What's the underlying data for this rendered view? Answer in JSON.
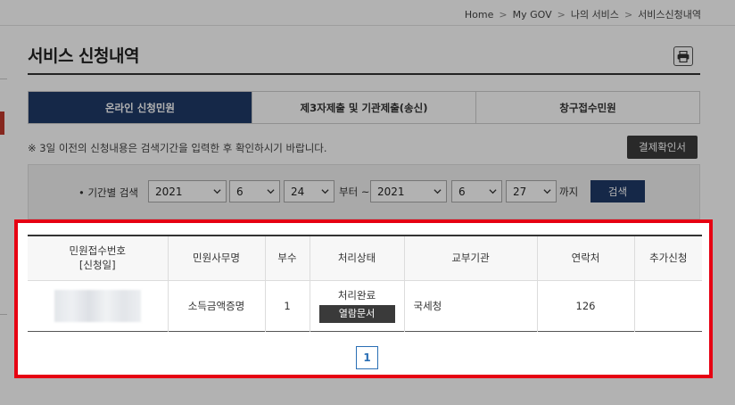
{
  "breadcrumb": [
    "Home",
    "My GOV",
    "나의 서비스",
    "서비스신청내역"
  ],
  "page": {
    "title": "서비스 신청내역"
  },
  "icons": {
    "print": "printer-icon",
    "caret": "chevron-down-icon"
  },
  "tabs": [
    {
      "label": "온라인 신청민원",
      "active": true
    },
    {
      "label": "제3자제출 및 기관제출(송신)",
      "active": false
    },
    {
      "label": "창구접수민원",
      "active": false
    }
  ],
  "notice": "※ 3일 이전의 신청내용은 검색기간을 입력한 후 확인하시기 바랍니다.",
  "receipt_button": "결제확인서",
  "search": {
    "label": "• 기간별 검색",
    "from": {
      "year": "2021",
      "month": "6",
      "day": "24"
    },
    "between": "부터 ~",
    "to": {
      "year": "2021",
      "month": "6",
      "day": "27"
    },
    "suffix": "까지",
    "button": "검색"
  },
  "table": {
    "headers": {
      "receipt_no": "민원접수번호",
      "receipt_date": "[신청일]",
      "service_name": "민원사무명",
      "copies": "부수",
      "status": "처리상태",
      "agency": "교부기관",
      "contact": "연락처",
      "extra": "추가신청"
    },
    "rows": [
      {
        "service_name": "소득금액증명",
        "copies": "1",
        "status": "처리완료",
        "action": "열람문서",
        "agency": "국세청",
        "contact": "126",
        "extra": ""
      }
    ]
  },
  "pagination": {
    "current": "1"
  },
  "colors": {
    "primary": "#1f3a68",
    "highlight": "#e60012",
    "link": "#2a6fb5"
  }
}
